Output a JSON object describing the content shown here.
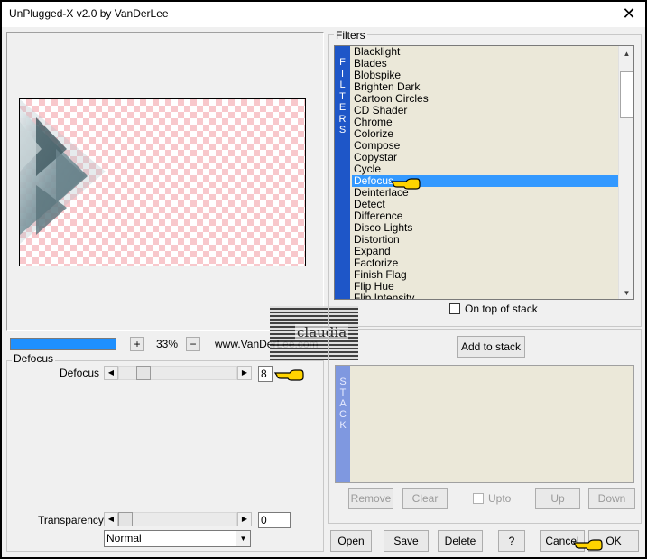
{
  "window": {
    "title": "UnPlugged-X v2.0 by VanDerLee",
    "close_glyph": "✕"
  },
  "zoom": {
    "minus": "−",
    "plus": "+",
    "value": "33%",
    "site": "www.VanDerLee.com",
    "progress": 1.0
  },
  "parameters": {
    "group_label": "Defocus",
    "defocus_label": "Defocus",
    "defocus_value": "8",
    "transparency_label": "Transparency",
    "transparency_value": "0",
    "blend_mode": "Normal"
  },
  "filters": {
    "group_label": "Filters",
    "strip_text": "FILTERS",
    "items": [
      "Blacklight",
      "Blades",
      "Blobspike",
      "Brighten Dark",
      "Cartoon Circles",
      "CD Shader",
      "Chrome",
      "Colorize",
      "Compose",
      "Copystar",
      "Cycle",
      "Defocus",
      "Deinterlace",
      "Detect",
      "Difference",
      "Disco Lights",
      "Distortion",
      "Expand",
      "Factorize",
      "Finish Flag",
      "Flip Hue",
      "Flip Intensity"
    ],
    "selected": "Defocus",
    "on_top_label": "On top of stack",
    "on_top_checked": false
  },
  "stack": {
    "add_label": "Add to stack",
    "strip_text": "STACK",
    "remove_label": "Remove",
    "clear_label": "Clear",
    "upto_label": "Upto",
    "up_label": "Up",
    "down_label": "Down"
  },
  "footer": {
    "open": "Open",
    "save": "Save",
    "delete": "Delete",
    "help": "?",
    "cancel": "Cancel",
    "ok": "OK"
  },
  "watermark": {
    "text": "claudia"
  },
  "colors": {
    "strip": "#1e56c8",
    "selection": "#3399ff",
    "list_bg": "#ebe8d9",
    "stack_strip": "#7f98e0",
    "pointer_hand": "#ffd400"
  },
  "icons": {
    "pointer": "pointing-hand-icon",
    "close": "close-icon",
    "scroll_up": "scroll-up-arrow-icon",
    "scroll_down": "scroll-down-arrow-icon"
  }
}
